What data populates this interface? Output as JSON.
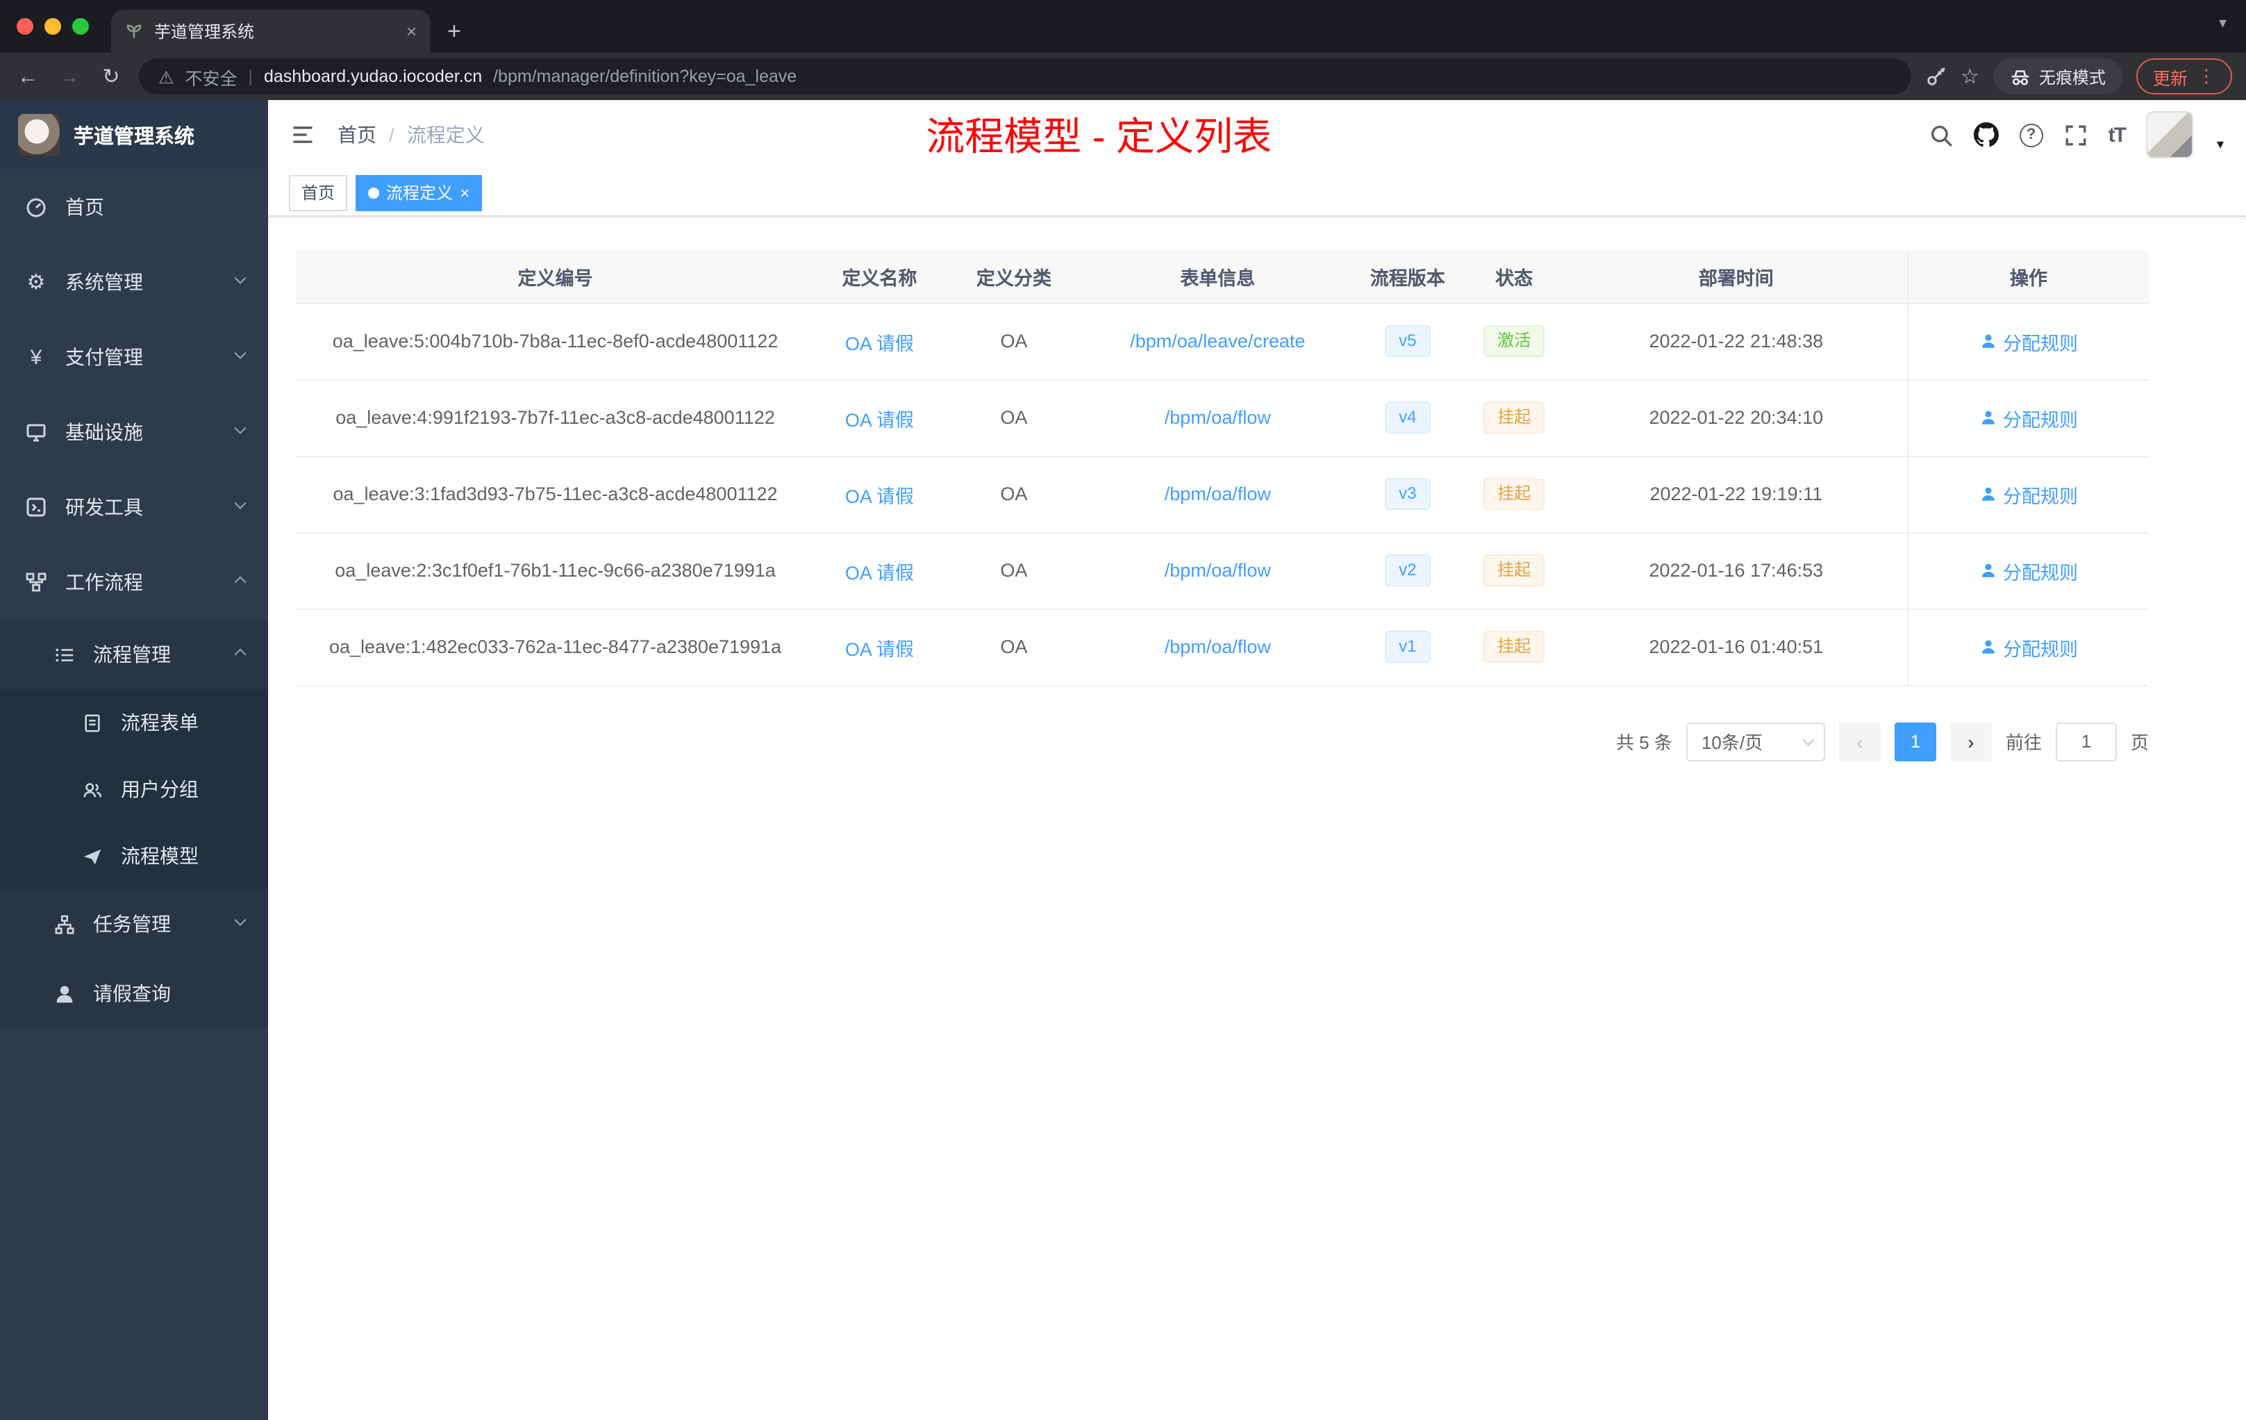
{
  "colors": {
    "accent": "#409eff",
    "title_red": "#ff0000",
    "success": "#67c23a",
    "warning": "#e6a23c",
    "sidebar_bg": "#2f3b4d"
  },
  "browser": {
    "tab_title": "芋道管理系统",
    "security_label": "不安全",
    "url_host": "dashboard.yudao.iocoder.cn",
    "url_path": "/bpm/manager/definition?key=oa_leave",
    "incognito_label": "无痕模式",
    "update_label": "更新",
    "icons": {
      "close": "×",
      "plus": "+",
      "dots": "⋮",
      "back": "←",
      "forward": "→",
      "reload": "↻",
      "warning": "⚠",
      "star": "☆",
      "caret": "▾",
      "pipe": "|"
    }
  },
  "sidebar": {
    "logo_title": "芋道管理系统",
    "items": [
      {
        "label": "首页"
      },
      {
        "label": "系统管理"
      },
      {
        "label": "支付管理"
      },
      {
        "label": "基础设施"
      },
      {
        "label": "研发工具"
      },
      {
        "label": "工作流程"
      },
      {
        "label": "流程管理"
      },
      {
        "label": "流程表单"
      },
      {
        "label": "用户分组"
      },
      {
        "label": "流程模型"
      },
      {
        "label": "任务管理"
      },
      {
        "label": "请假查询"
      }
    ]
  },
  "header": {
    "breadcrumb": {
      "home": "首页",
      "separator": "/",
      "current": "流程定义"
    },
    "page_title": "流程模型 - 定义列表",
    "text_size_icon": "tT",
    "question_glyph": "?"
  },
  "tags": {
    "home": "首页",
    "active": "流程定义",
    "close": "×"
  },
  "table": {
    "columns": [
      "定义编号",
      "定义名称",
      "定义分类",
      "表单信息",
      "流程版本",
      "状态",
      "部署时间",
      "操作"
    ],
    "rows": [
      {
        "id": "oa_leave:5:004b710b-7b8a-11ec-8ef0-acde48001122",
        "name": "OA 请假",
        "category": "OA",
        "form": "/bpm/oa/leave/create",
        "version": "v5",
        "status": "激活",
        "status_type": "success",
        "time": "2022-01-22 21:48:38",
        "action": "分配规则"
      },
      {
        "id": "oa_leave:4:991f2193-7b7f-11ec-a3c8-acde48001122",
        "name": "OA 请假",
        "category": "OA",
        "form": "/bpm/oa/flow",
        "version": "v4",
        "status": "挂起",
        "status_type": "warning",
        "time": "2022-01-22 20:34:10",
        "action": "分配规则"
      },
      {
        "id": "oa_leave:3:1fad3d93-7b75-11ec-a3c8-acde48001122",
        "name": "OA 请假",
        "category": "OA",
        "form": "/bpm/oa/flow",
        "version": "v3",
        "status": "挂起",
        "status_type": "warning",
        "time": "2022-01-22 19:19:11",
        "action": "分配规则"
      },
      {
        "id": "oa_leave:2:3c1f0ef1-76b1-11ec-9c66-a2380e71991a",
        "name": "OA 请假",
        "category": "OA",
        "form": "/bpm/oa/flow",
        "version": "v2",
        "status": "挂起",
        "status_type": "warning",
        "time": "2022-01-16 17:46:53",
        "action": "分配规则"
      },
      {
        "id": "oa_leave:1:482ec033-762a-11ec-8477-a2380e71991a",
        "name": "OA 请假",
        "category": "OA",
        "form": "/bpm/oa/flow",
        "version": "v1",
        "status": "挂起",
        "status_type": "warning",
        "time": "2022-01-16 01:40:51",
        "action": "分配规则"
      }
    ]
  },
  "pagination": {
    "total": "共 5 条",
    "page_size": "10条/页",
    "prev": "‹",
    "next": "›",
    "current_page": "1",
    "goto_label": "前往",
    "goto_value": "1",
    "page_unit": "页"
  }
}
